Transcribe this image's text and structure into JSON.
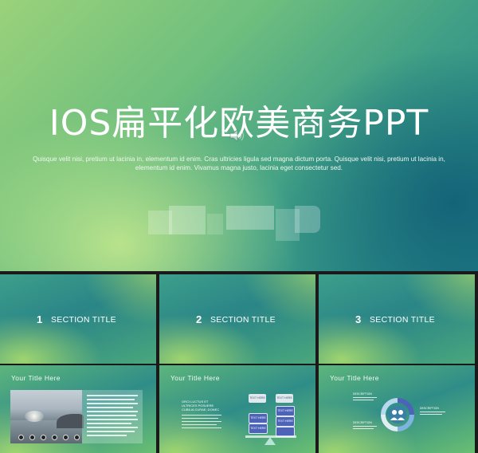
{
  "hero": {
    "title": "IOS扁平化欧美商务PPT",
    "subtitle": "Quisque velit nisi, pretium ut lacinia in, elementum id enim. Cras ultricies ligula sed magna dictum porta. Quisque velit nisi, pretium ut lacinia in, elementum id enim. Vivamus magna justo, lacinia eget consectetur sed."
  },
  "sections": [
    {
      "num": "1",
      "label": "SECTION TITLE"
    },
    {
      "num": "2",
      "label": "SECTION TITLE"
    },
    {
      "num": "3",
      "label": "SECTION TITLE"
    }
  ],
  "content_slides": [
    {
      "title": "Your Title Here"
    },
    {
      "title": "Your  Title  Here",
      "heading": "ORCI LUCTUS ET\nULTRICES POSUERE\nCUBILIA CURAE; DONEC",
      "tags": [
        "TEXT HERE",
        "TEXT HERE",
        "TEXT HERE",
        "TEXT HERE",
        "TEXT HERE",
        "TEXT HERE"
      ]
    },
    {
      "title": "Your  Title  Here",
      "desc_labels": [
        "DESCRIPTION",
        "DESCRIPTION",
        "DESCRIPTION"
      ]
    }
  ],
  "colors": {
    "accent": "#4c63b8",
    "green": "#8fcf7c",
    "teal": "#1f7f86"
  }
}
